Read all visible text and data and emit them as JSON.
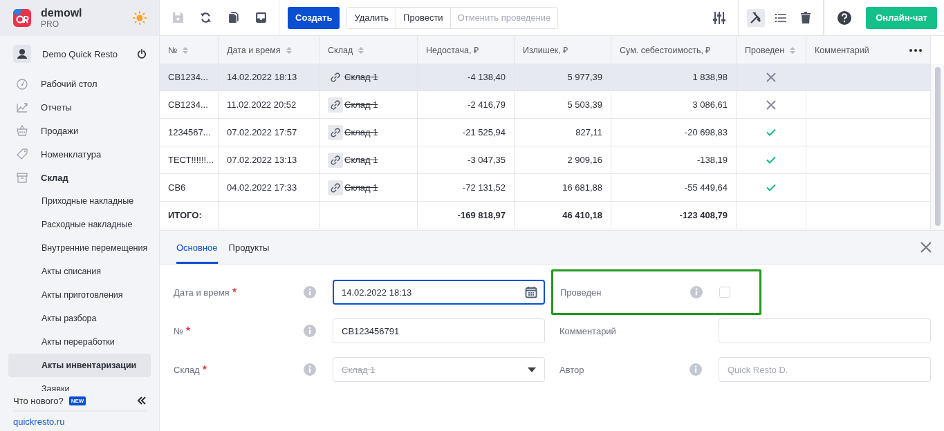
{
  "sidebar": {
    "brand": {
      "name": "demowl",
      "plan": "PRO"
    },
    "user": {
      "name": "Demo Quick Resto"
    },
    "nav": [
      {
        "label": "Рабочий стол",
        "expanded": false
      },
      {
        "label": "Отчеты",
        "expanded": false
      },
      {
        "label": "Продажи",
        "expanded": false
      },
      {
        "label": "Номенклатура",
        "expanded": false
      },
      {
        "label": "Склад",
        "expanded": true,
        "children": [
          {
            "label": "Приходные накладные",
            "selected": false
          },
          {
            "label": "Расходные накладные",
            "selected": false
          },
          {
            "label": "Внутренние перемещения",
            "selected": false
          },
          {
            "label": "Акты списания",
            "selected": false
          },
          {
            "label": "Акты приготовления",
            "selected": false
          },
          {
            "label": "Акты разбора",
            "selected": false
          },
          {
            "label": "Акты переработки",
            "selected": false
          },
          {
            "label": "Акты инвентаризации",
            "selected": true
          },
          {
            "label": "Заявки",
            "selected": false
          }
        ]
      }
    ],
    "whats_new": "Что нового?",
    "new_badge": "NEW",
    "site_link": "quickresto.ru"
  },
  "toolbar": {
    "create": "Создать",
    "actions": [
      {
        "label": "Удалить",
        "disabled": false
      },
      {
        "label": "Провести",
        "disabled": false
      },
      {
        "label": "Отменить проведение",
        "disabled": true
      }
    ],
    "chat": "Онлайн-чат"
  },
  "table": {
    "columns": [
      {
        "label": "№",
        "sortable": true
      },
      {
        "label": "Дата и время",
        "sortable": true
      },
      {
        "label": "Склад",
        "sortable": true
      },
      {
        "label": "Недостача, ₽",
        "sortable": false
      },
      {
        "label": "Излишек, ₽",
        "sortable": false
      },
      {
        "label": "Сум. себестоимость, ₽",
        "sortable": false
      },
      {
        "label": "Проведен",
        "sortable": true
      },
      {
        "label": "Комментарий",
        "sortable": false
      }
    ],
    "rows": [
      {
        "number": "СВ1234...",
        "date": "14.02.2022 18:13",
        "warehouse": "Склад 1",
        "deleted": true,
        "shortage": "-4 138,40",
        "surplus": "5 977,39",
        "cost": "1 838,98",
        "posted": false,
        "selected": true
      },
      {
        "number": "СВ1234...",
        "date": "11.02.2022 20:52",
        "warehouse": "Склад 1",
        "deleted": true,
        "shortage": "-2 416,79",
        "surplus": "5 503,39",
        "cost": "3 086,61",
        "posted": false,
        "selected": false
      },
      {
        "number": "1234567...",
        "date": "07.02.2022 17:57",
        "warehouse": "Склад 1",
        "deleted": true,
        "shortage": "-21 525,94",
        "surplus": "827,11",
        "cost": "-20 698,83",
        "posted": true,
        "selected": false
      },
      {
        "number": "ТЕСТ!!!!!!...",
        "date": "07.02.2022 13:13",
        "warehouse": "Склад 1",
        "deleted": true,
        "shortage": "-3 047,35",
        "surplus": "2 909,16",
        "cost": "-138,19",
        "posted": true,
        "selected": false
      },
      {
        "number": "СВ6",
        "date": "04.02.2022 17:33",
        "warehouse": "Склад 1",
        "deleted": true,
        "shortage": "-72 131,52",
        "surplus": "16 681,88",
        "cost": "-55 449,64",
        "posted": true,
        "selected": false
      }
    ],
    "total": {
      "label": "ИТОГО:",
      "shortage": "-169 818,97",
      "surplus": "46 410,18",
      "cost": "-123 408,79"
    }
  },
  "detail": {
    "tabs": [
      {
        "label": "Основное",
        "selected": true
      },
      {
        "label": "Продукты",
        "selected": false
      }
    ],
    "left_fields": [
      {
        "label": "Дата и время",
        "required": true,
        "info": true,
        "kind": "date",
        "value": "14.02.2022 18:13",
        "focused": true
      },
      {
        "label": "№",
        "required": true,
        "info": true,
        "kind": "text",
        "value": "СВ123456791",
        "focused": false
      },
      {
        "label": "Склад",
        "required": true,
        "info": true,
        "kind": "select",
        "value": "Склад 1",
        "deleted": true,
        "focused": false
      }
    ],
    "right_fields": [
      {
        "label": "Проведен",
        "info": true,
        "kind": "checkbox",
        "checked": false,
        "highlighted": true
      },
      {
        "label": "Комментарий",
        "kind": "text",
        "focused": false
      },
      {
        "label": "Автор",
        "info": true,
        "kind": "text",
        "placeholder": "Quick Resto D.",
        "focused": false
      }
    ]
  }
}
